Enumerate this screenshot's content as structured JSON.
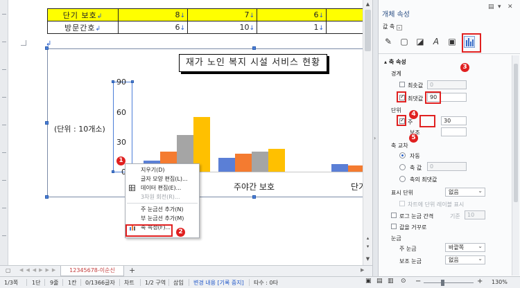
{
  "table": {
    "rows": [
      {
        "label": "단기 보호",
        "values": [
          "8",
          "7",
          "6"
        ],
        "highlight": true
      },
      {
        "label": "방문간호",
        "values": [
          "6",
          "10",
          "1"
        ],
        "highlight": false
      }
    ],
    "row_mark": "↲",
    "cell_mark": "↓"
  },
  "chart": {
    "title": "재가 노인 복지 시설 서비스 현황",
    "unit_label": "(단위 : 10개소)",
    "y_ticks": [
      "90",
      "60",
      "30",
      "0"
    ],
    "categories": [
      "주야간 보호",
      "단기"
    ]
  },
  "chart_data": {
    "type": "bar",
    "title": "재가 노인 복지 시설 서비스 현황",
    "ylabel": "(단위 : 10개소)",
    "ylim": [
      0,
      90
    ],
    "categories": [
      "",
      "주야간 보호",
      "단기"
    ],
    "series": [
      {
        "values": [
          11,
          14,
          8
        ],
        "color": "#5b7fd6"
      },
      {
        "values": [
          20,
          18,
          6
        ],
        "color": "#f47b30"
      },
      {
        "values": [
          37,
          20,
          7
        ],
        "color": "#a5a5a5"
      },
      {
        "values": [
          55,
          23,
          0
        ],
        "color": "#ffc000"
      }
    ]
  },
  "context_menu": {
    "items": [
      {
        "label": "지우기(D)",
        "disabled": false
      },
      {
        "label": "글자 모양 편집(L)...",
        "disabled": false
      },
      {
        "label": "데이터 편집(E)...",
        "disabled": false
      },
      {
        "label": "3차원 회전(R)...",
        "disabled": true
      },
      {
        "label": "주 눈금선 추가(N)",
        "disabled": false
      },
      {
        "label": "부 눈금선 추가(M)",
        "disabled": false
      },
      {
        "label": "축 속성(F)...",
        "disabled": false
      }
    ]
  },
  "badges": [
    "1",
    "2",
    "3",
    "4",
    "5"
  ],
  "panel": {
    "title": "개체 속성",
    "axis_select": "값 축",
    "section": "축 속성",
    "bounds_label": "경계",
    "min_label": "최솟값",
    "min_value": "0",
    "max_label": "최댓값",
    "max_value": "90",
    "unit_label": "단위",
    "major_label": "주",
    "major_value": "30",
    "minor_label": "보조",
    "cross_label": "축 교차",
    "cross_auto": "자동",
    "cross_value_label": "축 값",
    "cross_value": "0",
    "cross_max": "축의 최댓값",
    "display_unit_label": "표시 단위",
    "display_unit_value": "없음",
    "display_unit_chart": "차트에 단위 레이블 표시",
    "log_label": "로그 눈금 간격",
    "log_base_label": "기준",
    "log_base_value": "10",
    "reverse_label": "값을 거꾸로",
    "tick_label": "눈금",
    "major_tick_label": "주 눈금",
    "major_tick_value": "바깥쪽",
    "minor_tick_label": "보조 눈금",
    "minor_tick_value": "없음"
  },
  "tab": {
    "label": "12345678-이순신",
    "add": "+"
  },
  "status": {
    "page": "1/3쪽",
    "section": "1단",
    "line": "9줄",
    "col": "1칸",
    "chars": "0/1366글자",
    "obj": "차트",
    "area": "1/2 구역",
    "mode": "삽입",
    "track": "변경 내용 [기록 중지]",
    "count": "타수 : 0타",
    "zoom": "130%"
  },
  "colors": {
    "accent_red": "#e02020",
    "panel_title": "#2b4f85",
    "highlight_yellow": "#ffff00"
  }
}
